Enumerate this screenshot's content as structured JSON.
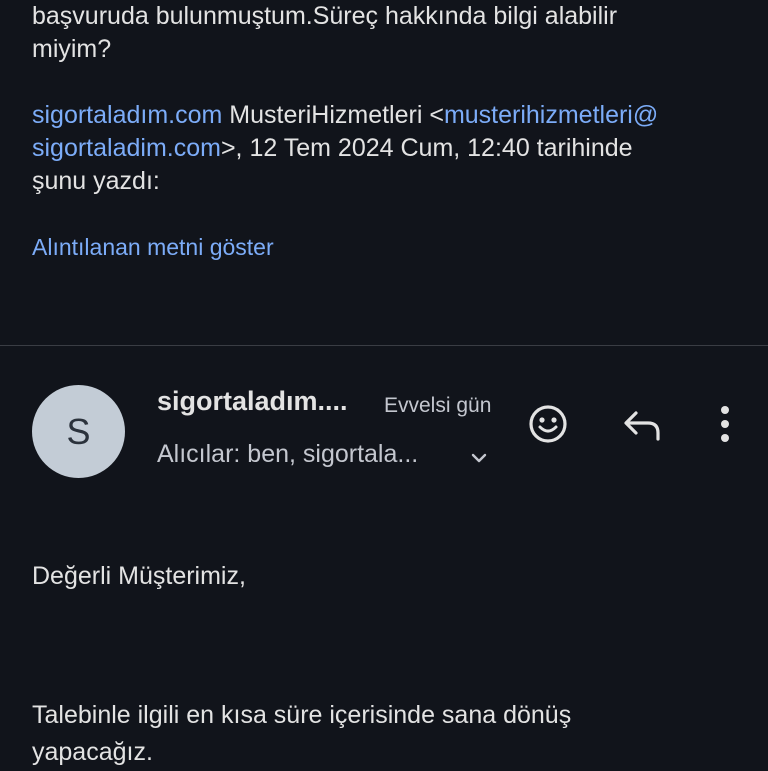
{
  "quoted": {
    "line1": "başvuruda bulunmuştum.Süreç hakkında bilgi alabilir",
    "line2": "miyim?",
    "attribution": {
      "sender_link": "sigortaladım.com",
      "sender_name": " MusteriHizmetleri <",
      "email_part1": "musterihizmetleri@",
      "email_part2": "sigortaladim.com",
      "after_email": ">, 12 Tem 2024 Cum, 12:40 tarihinde",
      "line3": "şunu yazdı:"
    },
    "show_quoted_label": "Alıntılanan metni göster"
  },
  "message": {
    "avatar_letter": "S",
    "sender": "sigortaladım....",
    "date": "Evvelsi gün",
    "recipients": "Alıcılar: ben, sigortala...",
    "greeting": "Değerli Müşterimiz,",
    "body_line1": "Talebinle ilgili en kısa süre içerisinde sana dönüş",
    "body_line2": "yapacağız."
  },
  "icons": {
    "emoji": "add-reaction-icon",
    "reply": "reply-icon",
    "more": "more-vert-icon",
    "expand": "chevron-down-icon"
  },
  "colors": {
    "background": "#11141b",
    "link": "#7cacf8",
    "text": "#e3e3e3",
    "secondary_text": "#c4c7cf",
    "avatar_bg": "#c3ccd6"
  }
}
